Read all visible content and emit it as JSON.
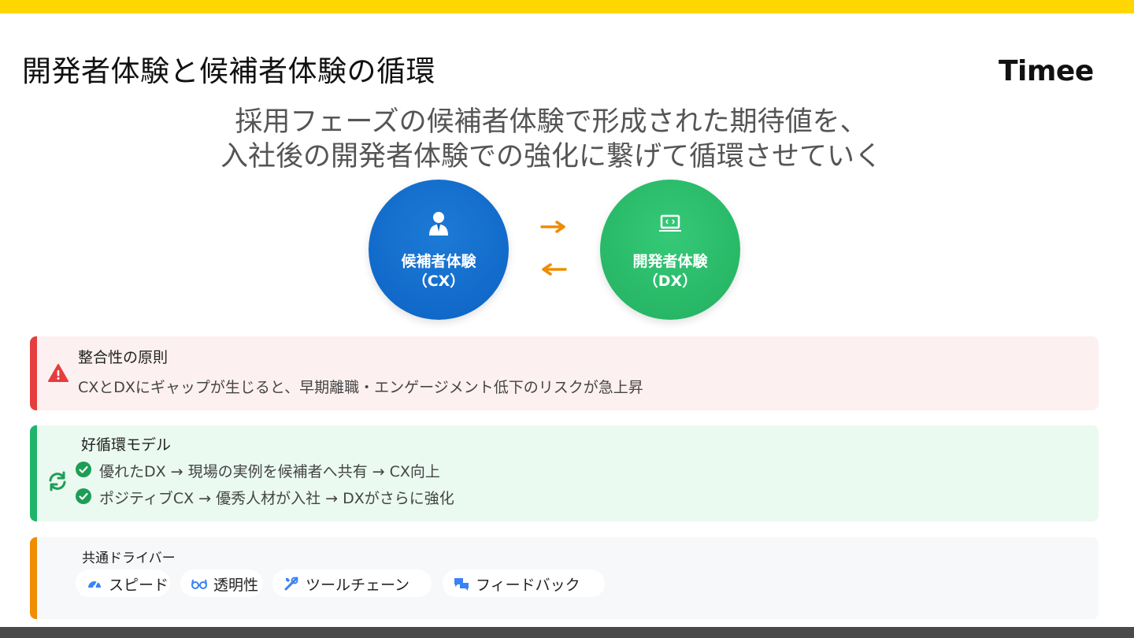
{
  "page": {
    "title": "開発者体験と候補者体験の循環",
    "logo_text": "Timee",
    "subtitle_lines": [
      "採用フェーズの候補者体験で形成された期待値を、",
      "入社後の開発者体験での強化に繋げて循環させていく"
    ]
  },
  "cycle_diagram": {
    "cx": {
      "label_line1": "候補者体験",
      "label_line2": "（CX）",
      "icon": "user-icon",
      "color": "#0c63c4"
    },
    "dx": {
      "label_line1": "開発者体験",
      "label_line2": "（DX）",
      "icon": "laptop-code-icon",
      "color": "#22b05f"
    },
    "arrows": [
      "arrow-right-icon",
      "arrow-left-icon"
    ],
    "arrow_color": "#f08c00"
  },
  "principle": {
    "icon": "warning-icon",
    "title": "整合性の原則",
    "text": "CXとDXにギャップが生じると、早期離職・エンゲージメント低下のリスクが急上昇",
    "accent_color": "#e53e3e"
  },
  "cycle_model": {
    "icon": "sync-icon",
    "title": "好循環モデル",
    "items": [
      "優れたDX → 現場の実例を候補者へ共有 → CX向上",
      "ポジティブCX → 優秀人材が入社 → DXがさらに強化"
    ],
    "accent_color": "#20b46a"
  },
  "drivers": {
    "title": "共通ドライバー",
    "chips": [
      {
        "label": "スピード",
        "icon": "speedometer-icon"
      },
      {
        "label": "透明性",
        "icon": "glasses-icon"
      },
      {
        "label": "ツールチェーン",
        "icon": "tools-icon"
      },
      {
        "label": "フィードバック",
        "icon": "comments-icon"
      }
    ],
    "accent_color": "#f08c00"
  }
}
